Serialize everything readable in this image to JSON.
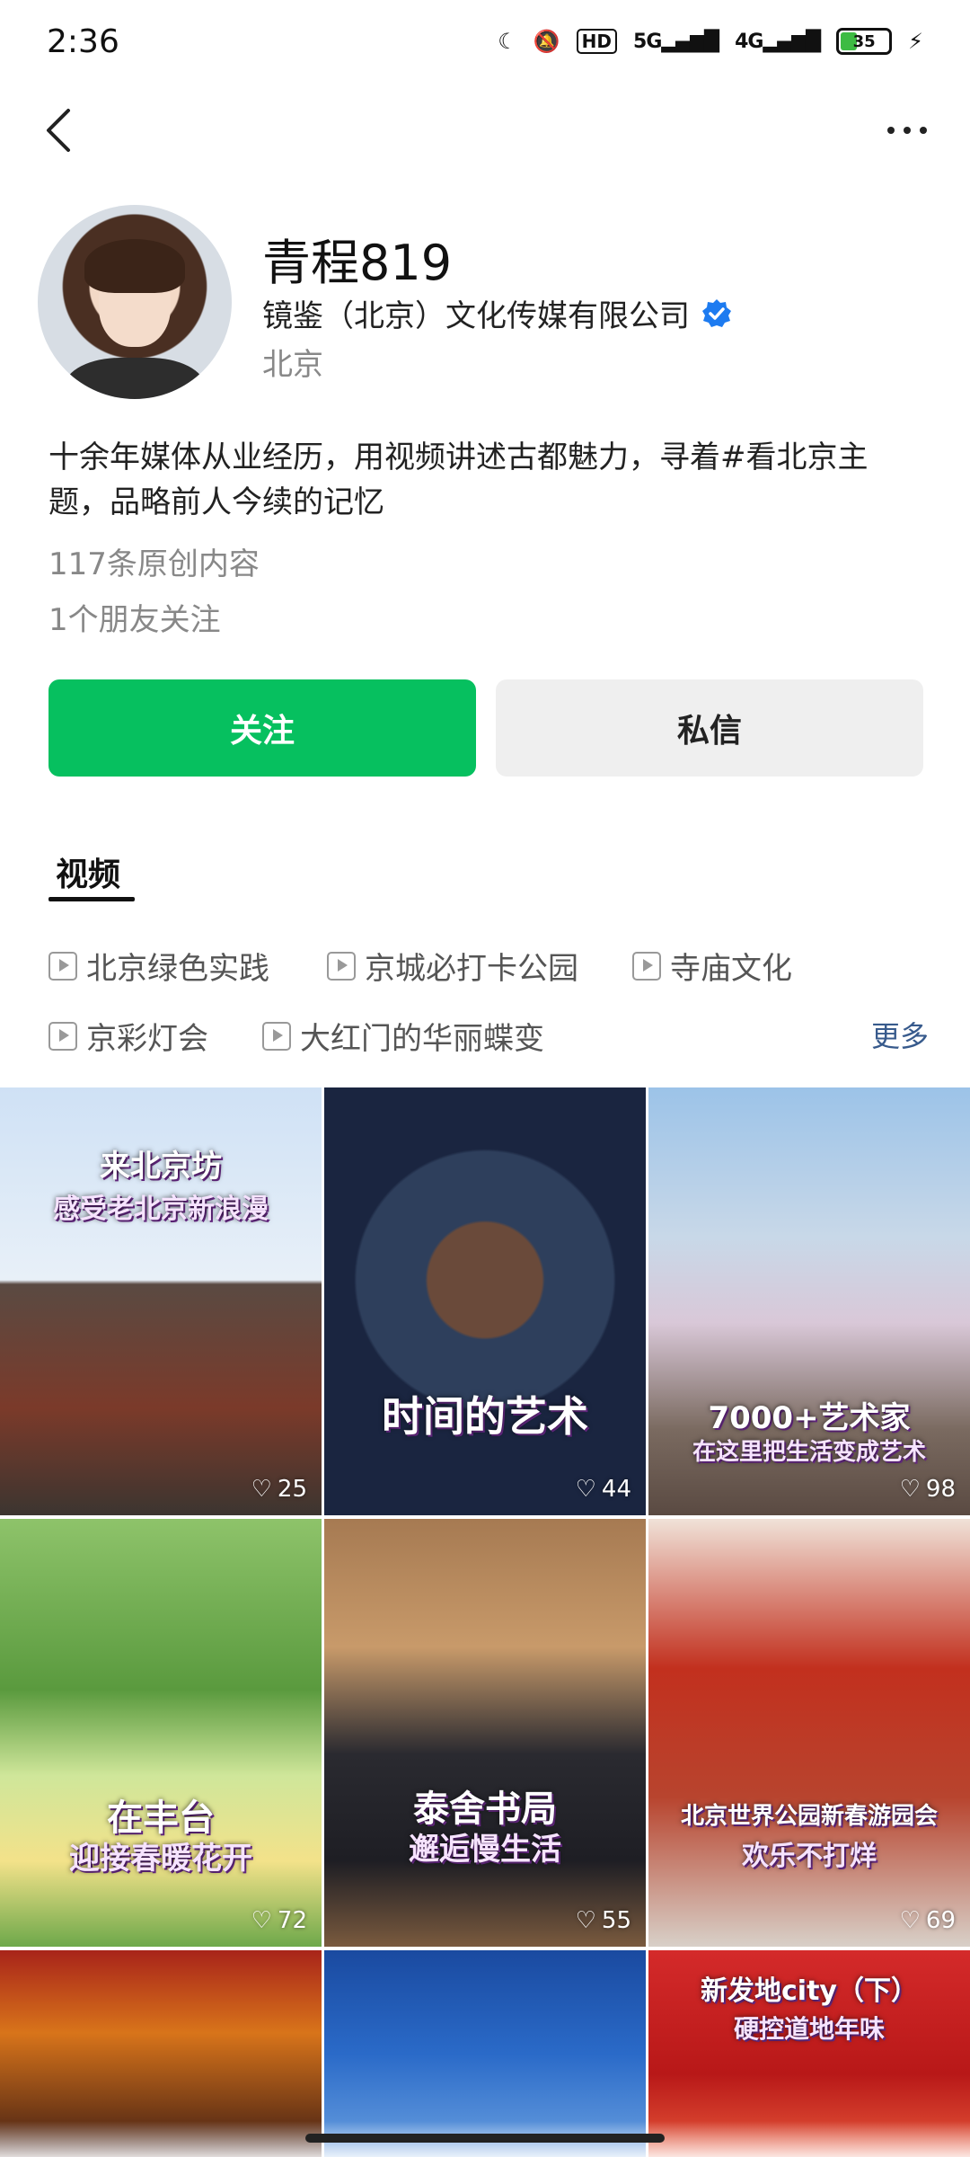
{
  "status_bar": {
    "time": "2:36",
    "hd": "HD",
    "net1": "5G",
    "net2": "4G",
    "battery": "35",
    "battery_level": 0.35
  },
  "profile": {
    "name": "青程819",
    "company": "镜鉴（北京）文化传媒有限公司",
    "location": "北京",
    "bio": "十余年媒体从业经历，用视频讲述古都魅力，寻着#看北京主题，品略前人今续的记忆",
    "original_count": "117条原创内容",
    "friends_follow": "1个朋友关注"
  },
  "actions": {
    "follow": "关注",
    "message": "私信"
  },
  "tabs": {
    "video": "视频"
  },
  "topics": [
    "北京绿色实践",
    "京城必打卡公园",
    "寺庙文化",
    "京彩灯会",
    "大红门的华丽蝶变"
  ],
  "more_label": "更多",
  "videos": [
    {
      "title": "来北京坊",
      "subtitle": "感受老北京新浪漫",
      "likes": "25"
    },
    {
      "title": "时间的艺术",
      "subtitle": "",
      "likes": "44"
    },
    {
      "title": "7000+艺术家",
      "subtitle": "在这里把生活变成艺术",
      "likes": "98"
    },
    {
      "title": "在丰台",
      "subtitle": "迎接春暖花开",
      "likes": "72"
    },
    {
      "title": "泰舍书局",
      "subtitle": "邂逅慢生活",
      "likes": "55"
    },
    {
      "title": "北京世界公园新春游园会",
      "subtitle": "欢乐不打烊",
      "likes": "69"
    },
    {
      "title": "",
      "subtitle": "",
      "likes": ""
    },
    {
      "title": "",
      "subtitle": "",
      "likes": ""
    },
    {
      "title": "新发地city（下）",
      "subtitle": "硬控道地年味",
      "likes": ""
    }
  ],
  "colors": {
    "follow_green": "#06c05f",
    "verified_blue": "#1d7bf0",
    "more_blue": "#375a8c"
  }
}
